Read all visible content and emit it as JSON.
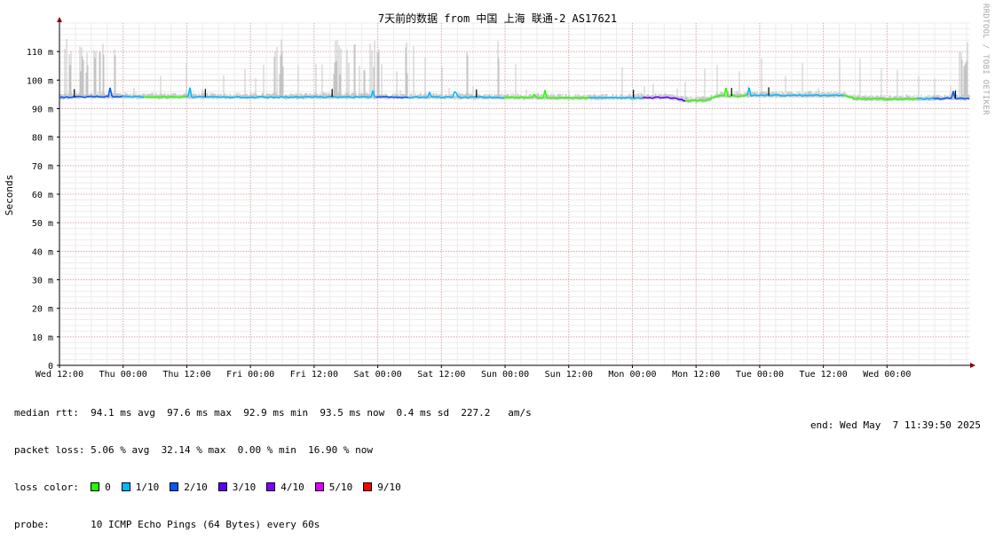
{
  "chart_data": {
    "type": "line",
    "title": "7天前的数据 from 中国 上海 联通-2 AS17621",
    "ylabel": "Seconds",
    "xlabel": "",
    "ylim": [
      0,
      0.12
    ],
    "y_ticks": [
      {
        "value": 0,
        "label": "0"
      },
      {
        "value": 0.01,
        "label": "10 m"
      },
      {
        "value": 0.02,
        "label": "20 m"
      },
      {
        "value": 0.03,
        "label": "30 m"
      },
      {
        "value": 0.04,
        "label": "40 m"
      },
      {
        "value": 0.05,
        "label": "50 m"
      },
      {
        "value": 0.06,
        "label": "60 m"
      },
      {
        "value": 0.07,
        "label": "70 m"
      },
      {
        "value": 0.08,
        "label": "80 m"
      },
      {
        "value": 0.09,
        "label": "90 m"
      },
      {
        "value": 0.1,
        "label": "100 m"
      },
      {
        "value": 0.11,
        "label": "110 m"
      }
    ],
    "x_tick_labels": [
      "Wed 12:00",
      "Thu 00:00",
      "Thu 12:00",
      "Fri 00:00",
      "Fri 12:00",
      "Sat 00:00",
      "Sat 12:00",
      "Sun 00:00",
      "Sun 12:00",
      "Mon 00:00",
      "Mon 12:00",
      "Tue 00:00",
      "Tue 12:00",
      "Wed 00:00"
    ],
    "xlim_hours": [
      0,
      171.67
    ],
    "grid": true,
    "median_rtt_series": {
      "name": "median rtt",
      "x_hours": [
        0,
        8,
        12,
        20,
        30,
        40,
        52,
        60,
        72,
        84,
        92,
        100,
        108,
        114,
        116,
        118,
        122,
        124,
        128,
        132,
        140,
        146,
        148,
        150,
        156,
        160,
        172
      ],
      "y_seconds": [
        0.0939,
        0.0943,
        0.0942,
        0.0941,
        0.0941,
        0.094,
        0.0941,
        0.094,
        0.094,
        0.0939,
        0.0938,
        0.0937,
        0.0938,
        0.0939,
        0.0936,
        0.0928,
        0.0929,
        0.0944,
        0.0945,
        0.0947,
        0.0946,
        0.0946,
        0.0947,
        0.0935,
        0.0933,
        0.0934,
        0.0936
      ]
    },
    "loss_colors": [
      {
        "label": "0",
        "color": "#26ff00"
      },
      {
        "label": "1/10",
        "color": "#00b8ff"
      },
      {
        "label": "2/10",
        "color": "#0059ff"
      },
      {
        "label": "3/10",
        "color": "#5e00ff"
      },
      {
        "label": "4/10",
        "color": "#7e00ff"
      },
      {
        "label": "5/10",
        "color": "#dd00ff"
      },
      {
        "label": "9/10",
        "color": "#ff0000"
      }
    ],
    "smoke_color": "#b4b4b4",
    "grid_color": "#e6a0a0",
    "axis_color": "#8b0000"
  },
  "side_credit": "RRDTOOL / TOBI OETIKER",
  "legend": {
    "median_line": "median rtt:  94.1 ms avg  97.6 ms max  92.9 ms min  93.5 ms now  0.4 ms sd  227.2   am/s",
    "packet_loss_line": "packet loss: 5.06 % avg  32.14 % max  0.00 % min  16.90 % now",
    "loss_color_label": "loss color:",
    "probe_line": "probe:       10 ICMP Echo Pings (64 Bytes) every 60s",
    "end_line": "end: Wed May  7 11:39:50 2025"
  }
}
